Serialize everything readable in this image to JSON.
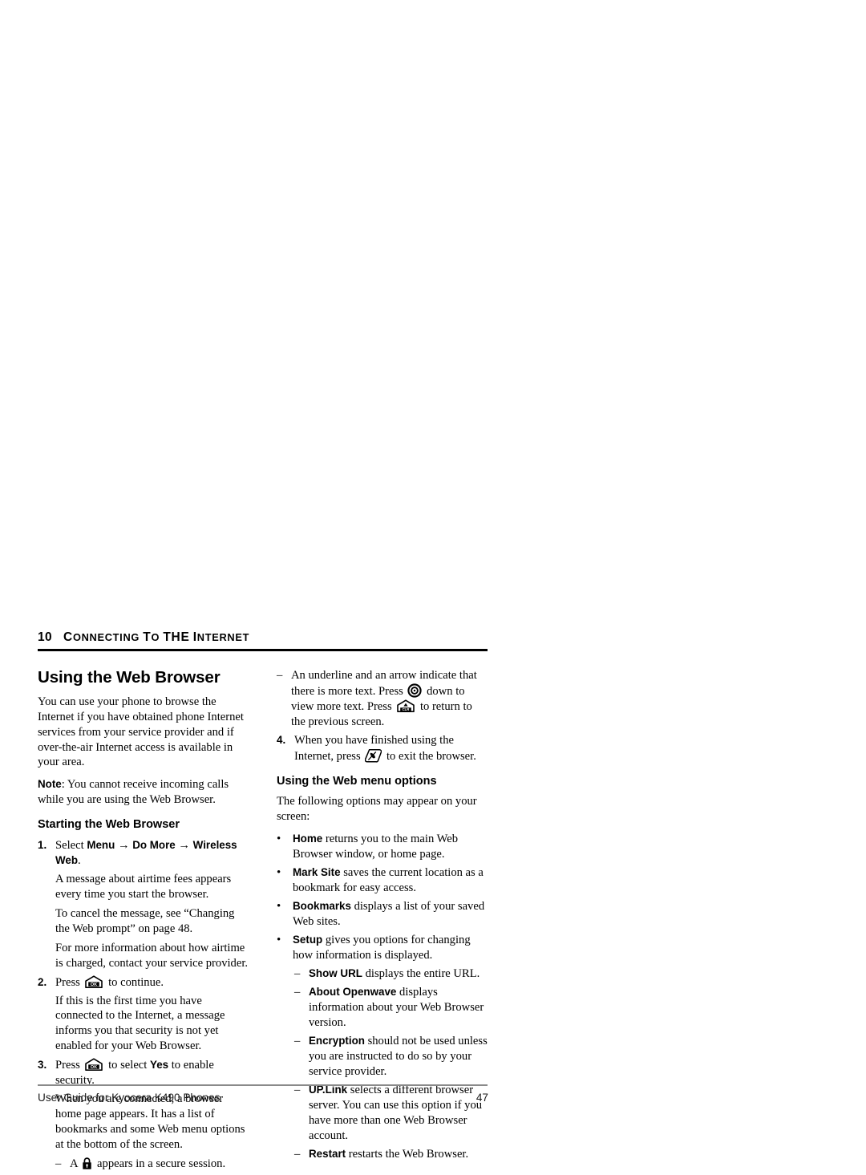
{
  "page": {
    "chapter_number": "10",
    "running_head": "CONNECTING TO THE INTERNET",
    "page_number": "47",
    "footer_text": "User Guide for Kyocera K490 Phones"
  },
  "left_column": {
    "heading": "Using the Web Browser",
    "intro": "You can use your phone to browse the Internet if you have obtained phone Internet services from your service provider and if over-the-air Internet access is available in your area.",
    "note_label": "Note",
    "note_text": ":  You cannot receive incoming calls while you are using the Web Browser.",
    "subheading": "Starting the Web Browser",
    "step1": {
      "marker": "1.",
      "lead": "Select ",
      "menu1": "Menu",
      "arrow": "→",
      "menu2": "Do More",
      "menu3": "Wireless Web",
      "period": ".",
      "para1": "A message about airtime fees appears every time you start the browser.",
      "para2": "To cancel the message, see “Changing the Web prompt” on page 48.",
      "para3": "For more information about how airtime is charged, contact your service provider."
    },
    "step2": {
      "marker": "2.",
      "before_icon": "Press ",
      "icon": "ok-key-icon",
      "after_icon": " to continue.",
      "para1": "If this is the first time you have connected to the Internet, a message informs you that security is not yet enabled for your Web Browser."
    },
    "step3": {
      "marker": "3.",
      "before_icon": "Press ",
      "icon": "ok-key-icon",
      "mid_text": " to select ",
      "bold_word": "Yes",
      "after_text": " to enable security.",
      "para1": "When you are connected, a browser home page appears. It has a list of bookmarks and some Web menu options at the bottom of the screen.",
      "sub_dash": {
        "marker": "–",
        "before_icon": "A ",
        "icon": "padlock-icon",
        "after_icon": " appears in a secure session."
      }
    }
  },
  "right_column": {
    "dash_item_1": {
      "marker": "–",
      "part1": "An underline and an arrow indicate that there is more text. Press ",
      "icon1": "navigation-key-icon",
      "part2": " down to view more text. Press ",
      "icon2": "clr-key-icon",
      "part3": " to return to the previous screen."
    },
    "step4": {
      "marker": "4.",
      "part1": "When you have finished using the Internet, press ",
      "icon": "end-call-key-icon",
      "part2": " to exit the browser."
    },
    "subheading": "Using the Web menu options",
    "intro": "The following options may appear on your screen:",
    "bullets": [
      {
        "marker": "•",
        "term": "Home",
        "desc": " returns you to the main Web Browser window, or home page."
      },
      {
        "marker": "•",
        "term": "Mark Site",
        "desc": " saves the current location as a bookmark for easy access."
      },
      {
        "marker": "•",
        "term": "Bookmarks",
        "desc": " displays a list of your saved Web sites."
      },
      {
        "marker": "•",
        "term": "Setup",
        "desc": " gives you options for changing how information is displayed."
      }
    ],
    "sub_dashes": [
      {
        "marker": "–",
        "term": "Show URL",
        "desc": " displays the entire URL."
      },
      {
        "marker": "–",
        "term": "About Openwave",
        "desc": " displays information about your Web Browser version."
      },
      {
        "marker": "–",
        "term": "Encryption",
        "desc": " should not be used unless you are instructed to do so by your service provider."
      },
      {
        "marker": "–",
        "term": "UP.Link",
        "desc": " selects a different browser server. You can use this option if you have more than one Web Browser account."
      },
      {
        "marker": "–",
        "term": "Restart",
        "desc": " restarts the Web Browser."
      }
    ]
  },
  "colors": {
    "text": "#000000",
    "rule_header": "#000000",
    "rule_footer": "#8a8a8a",
    "background": "#ffffff"
  }
}
